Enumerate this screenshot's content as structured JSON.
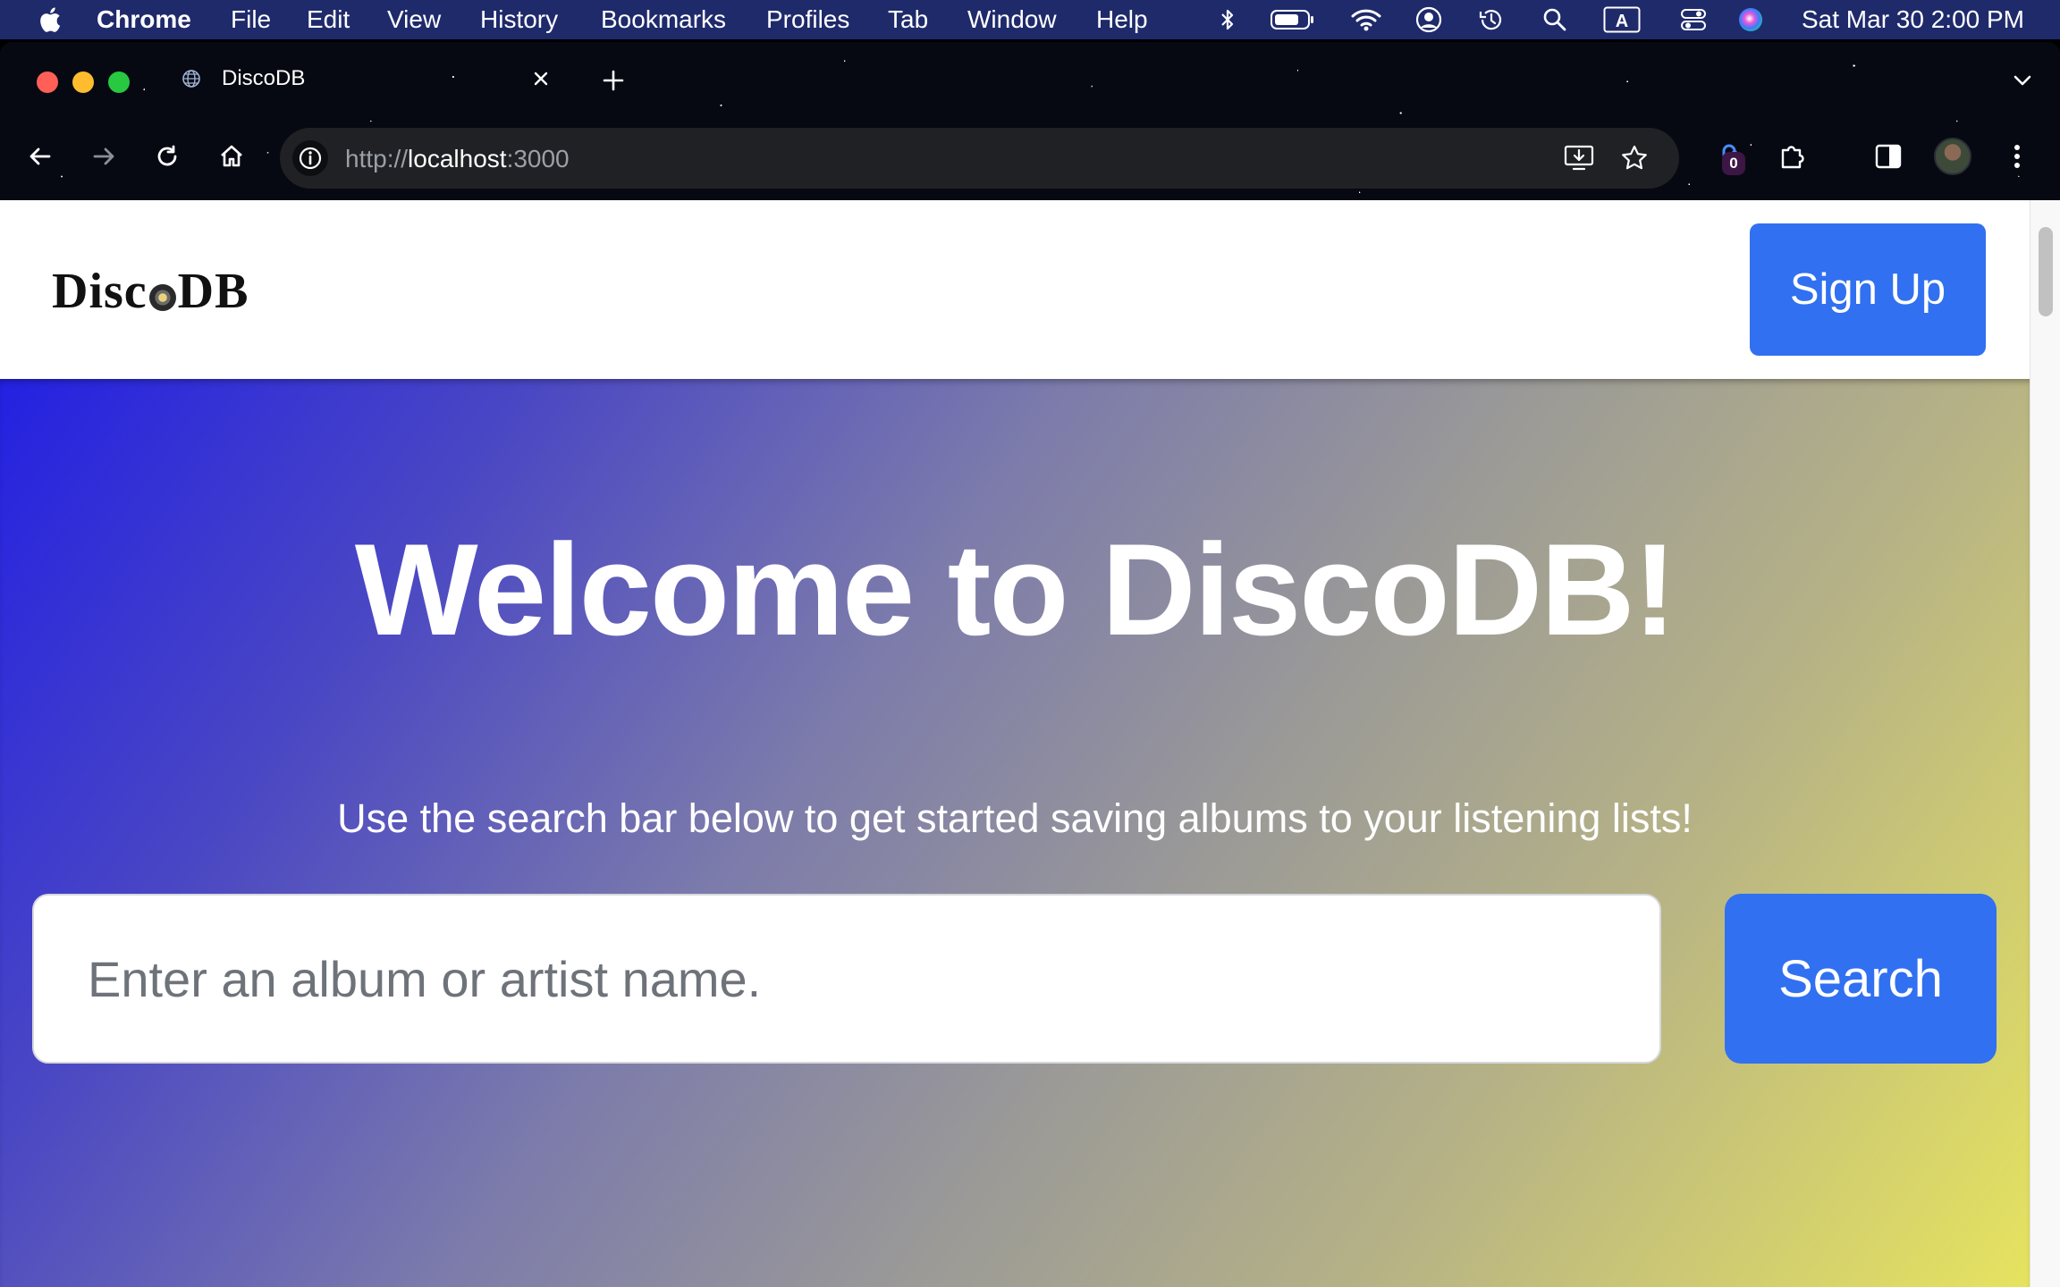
{
  "menubar": {
    "app_name": "Chrome",
    "items": [
      "File",
      "Edit",
      "View",
      "History",
      "Bookmarks",
      "Profiles",
      "Tab",
      "Window",
      "Help"
    ],
    "clock": "Sat Mar 30  2:00 PM"
  },
  "browser": {
    "tab_title": "DiscoDB",
    "url_scheme": "http://",
    "url_host": "localhost",
    "url_port": ":3000",
    "extension_badge": "0"
  },
  "site": {
    "logo_left": "Disc",
    "logo_right": "DB",
    "signup_label": "Sign Up",
    "hero_title": "Welcome to DiscoDB!",
    "hero_subtitle": "Use the search bar below to get started saving albums to your listening lists!",
    "search": {
      "placeholder": "Enter an album or artist name.",
      "value": "",
      "button_label": "Search"
    }
  },
  "colors": {
    "primary_button": "#3170f0",
    "gradient_start": "#2421e2",
    "gradient_end": "#e6e35f"
  }
}
